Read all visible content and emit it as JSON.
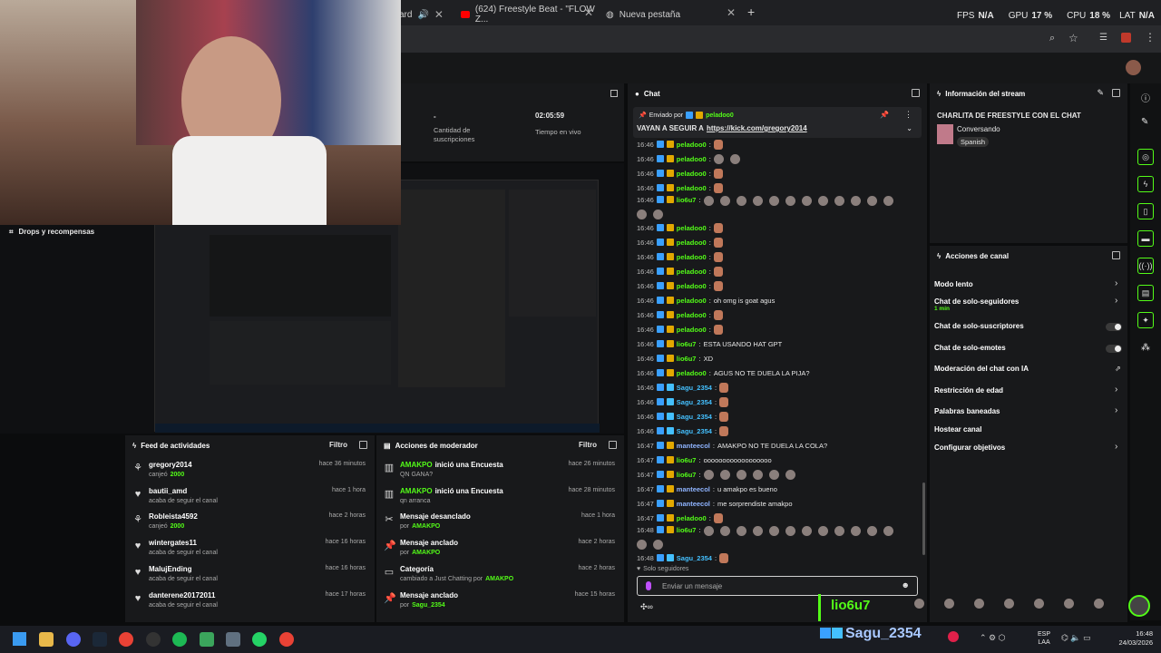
{
  "browser": {
    "tabs": [
      {
        "label": "ard"
      },
      {
        "label": "(624) Freestyle Beat - \"FLOW Z..."
      },
      {
        "label": "Nueva pestaña"
      }
    ],
    "stats": {
      "fps_label": "FPS",
      "fps_value": "N/A",
      "gpu_label": "GPU",
      "gpu_value": "17 %",
      "cpu_label": "CPU",
      "cpu_value": "18 %",
      "lat_label": "LAT",
      "lat_value": "N/A"
    }
  },
  "stream_stats": {
    "subs_value": "-",
    "subs_label": "Cantidad de suscripciones",
    "live_value": "02:05:59",
    "live_label": "Tiempo en vivo"
  },
  "drops": {
    "label": "Drops y recompensas"
  },
  "feed": {
    "title": "Feed de actividades",
    "filter": "Filtro",
    "items": [
      {
        "name": "gregory2014",
        "sub": "canjeó",
        "sub2": "2000",
        "time": "hace 36 minutos",
        "icon": "gift-icon"
      },
      {
        "name": "bautii_amd",
        "sub": "acaba de seguir el canal",
        "sub2": "",
        "time": "hace 1 hora",
        "icon": "heart-icon"
      },
      {
        "name": "Robleista4592",
        "sub": "canjeó",
        "sub2": "2000",
        "time": "hace 2 horas",
        "icon": "gift-icon"
      },
      {
        "name": "wintergates11",
        "sub": "acaba de seguir el canal",
        "sub2": "",
        "time": "hace 16 horas",
        "icon": "heart-icon"
      },
      {
        "name": "MalujEnding",
        "sub": "acaba de seguir el canal",
        "sub2": "",
        "time": "hace 16 horas",
        "icon": "heart-icon"
      },
      {
        "name": "danterene20172011",
        "sub": "acaba de seguir el canal",
        "sub2": "",
        "time": "hace 17 horas",
        "icon": "heart-icon"
      }
    ]
  },
  "modactions": {
    "title": "Acciones de moderador",
    "filter": "Filtro",
    "items": [
      {
        "user": "AMAKPO",
        "action": "inició una Encuesta",
        "sub": "QN GANA?",
        "by": "",
        "time": "hace 26 minutos",
        "icon": "poll-icon"
      },
      {
        "user": "AMAKPO",
        "action": "inició una Encuesta",
        "sub": "qn arranca",
        "by": "",
        "time": "hace 28 minutos",
        "icon": "poll-icon"
      },
      {
        "user": "",
        "action": "Mensaje desanclado",
        "sub": "por",
        "by": "AMAKPO",
        "time": "hace 1 hora",
        "icon": "unpin-icon"
      },
      {
        "user": "",
        "action": "Mensaje anclado",
        "sub": "por",
        "by": "AMAKPO",
        "time": "hace 2 horas",
        "icon": "pin-icon"
      },
      {
        "user": "",
        "action": "Categoría",
        "sub": "cambiado a Just Chatting por",
        "by": "AMAKPO",
        "time": "hace 2 horas",
        "icon": "category-icon"
      },
      {
        "user": "",
        "action": "Mensaje anclado",
        "sub": "por",
        "by": "Sagu_2354",
        "time": "hace 15 horas",
        "icon": "pin-icon"
      }
    ]
  },
  "chat": {
    "title": "Chat",
    "pinned_by": "Enviado por",
    "pinned_user": "peladoo0",
    "pinned_text": "VAYAN A SEGUIR A",
    "pinned_link": "https://kick.com/gregory2014",
    "lines": [
      {
        "time": "16:46",
        "user": "peladoo0",
        "color": "#53fc18",
        "text": "",
        "emotes": 1
      },
      {
        "time": "16:46",
        "user": "peladoo0",
        "color": "#53fc18",
        "text": "",
        "emotes": 2
      },
      {
        "time": "16:46",
        "user": "peladoo0",
        "color": "#53fc18",
        "text": "",
        "emotes": 1
      },
      {
        "time": "16:46",
        "user": "peladoo0",
        "color": "#53fc18",
        "text": "",
        "emotes": 1
      },
      {
        "time": "16:46",
        "user": "lio6u7",
        "color": "#53fc18",
        "text": "",
        "emotes": 14
      },
      {
        "time": "16:46",
        "user": "peladoo0",
        "color": "#53fc18",
        "text": "",
        "emotes": 1
      },
      {
        "time": "16:46",
        "user": "peladoo0",
        "color": "#53fc18",
        "text": "",
        "emotes": 1
      },
      {
        "time": "16:46",
        "user": "peladoo0",
        "color": "#53fc18",
        "text": "",
        "emotes": 1
      },
      {
        "time": "16:46",
        "user": "peladoo0",
        "color": "#53fc18",
        "text": "",
        "emotes": 1
      },
      {
        "time": "16:46",
        "user": "peladoo0",
        "color": "#53fc18",
        "text": "",
        "emotes": 1
      },
      {
        "time": "16:46",
        "user": "peladoo0",
        "color": "#53fc18",
        "text": "oh omg is goat agus",
        "emotes": 0
      },
      {
        "time": "16:46",
        "user": "peladoo0",
        "color": "#53fc18",
        "text": "",
        "emotes": 1
      },
      {
        "time": "16:46",
        "user": "peladoo0",
        "color": "#53fc18",
        "text": "",
        "emotes": 1
      },
      {
        "time": "16:46",
        "user": "lio6u7",
        "color": "#53fc18",
        "text": "ESTA USANDO HAT GPT",
        "emotes": 0
      },
      {
        "time": "16:46",
        "user": "lio6u7",
        "color": "#53fc18",
        "text": "XD",
        "emotes": 0
      },
      {
        "time": "16:46",
        "user": "peladoo0",
        "color": "#53fc18",
        "text": "AGUS NO TE DUELA LA PIJA?",
        "emotes": 0
      },
      {
        "time": "16:46",
        "user": "Sagu_2354",
        "color": "#44c0ff",
        "text": "",
        "emotes": 1
      },
      {
        "time": "16:46",
        "user": "Sagu_2354",
        "color": "#44c0ff",
        "text": "",
        "emotes": 1
      },
      {
        "time": "16:46",
        "user": "Sagu_2354",
        "color": "#44c0ff",
        "text": "",
        "emotes": 1
      },
      {
        "time": "16:46",
        "user": "Sagu_2354",
        "color": "#44c0ff",
        "text": "",
        "emotes": 1
      },
      {
        "time": "16:47",
        "user": "manteecol",
        "color": "#8fb4ff",
        "text": "AMAKPO NO TE DUELA LA COLA?",
        "emotes": 0
      },
      {
        "time": "16:47",
        "user": "lio6u7",
        "color": "#53fc18",
        "text": "oooooooooooooooooo",
        "emotes": 0
      },
      {
        "time": "16:47",
        "user": "lio6u7",
        "color": "#53fc18",
        "text": "",
        "emotes": 6
      },
      {
        "time": "16:47",
        "user": "manteecol",
        "color": "#8fb4ff",
        "text": "u amakpo es bueno",
        "emotes": 0
      },
      {
        "time": "16:47",
        "user": "manteecol",
        "color": "#8fb4ff",
        "text": "me sorprendiste amakpo",
        "emotes": 0
      },
      {
        "time": "16:47",
        "user": "peladoo0",
        "color": "#53fc18",
        "text": "",
        "emotes": 1
      },
      {
        "time": "16:48",
        "user": "lio6u7",
        "color": "#53fc18",
        "text": "",
        "emotes": 14
      },
      {
        "time": "16:48",
        "user": "Sagu_2354",
        "color": "#44c0ff",
        "text": "",
        "emotes": 1
      }
    ],
    "followers_only": "Solo seguidores",
    "input_placeholder": "Enviar un mensaje"
  },
  "overlay": {
    "user1": "lio6u7",
    "user2": "Sagu_2354"
  },
  "stream_info": {
    "title": "Información del stream",
    "stream_title": "CHARLITA DE FREESTYLE CON EL CHAT",
    "category": "Conversando",
    "language": "Spanish"
  },
  "channel_actions": {
    "title": "Acciones de canal",
    "items": [
      {
        "label": "Modo lento",
        "sub": "",
        "control": "chevron"
      },
      {
        "label": "Chat de solo-seguidores",
        "sub": "1 min",
        "control": "chevron"
      },
      {
        "label": "Chat de solo-suscriptores",
        "sub": "",
        "control": "toggle"
      },
      {
        "label": "Chat de solo-emotes",
        "sub": "",
        "control": "toggle"
      },
      {
        "label": "Moderación del chat con IA",
        "sub": "",
        "control": "external"
      },
      {
        "label": "Restricción de edad",
        "sub": "",
        "control": "chevron"
      },
      {
        "label": "Palabras baneadas",
        "sub": "",
        "control": "chevron"
      },
      {
        "label": "Hostear canal",
        "sub": "",
        "control": "none"
      },
      {
        "label": "Configurar objetivos",
        "sub": "",
        "control": "chevron"
      }
    ]
  },
  "taskbar": {
    "lang": "ESP",
    "lang2": "LAA",
    "time": "16:48",
    "date": "24/03/2026"
  },
  "colors": {
    "accent": "#53fc18",
    "panel": "#18191b",
    "bg": "#0b0c0d"
  }
}
